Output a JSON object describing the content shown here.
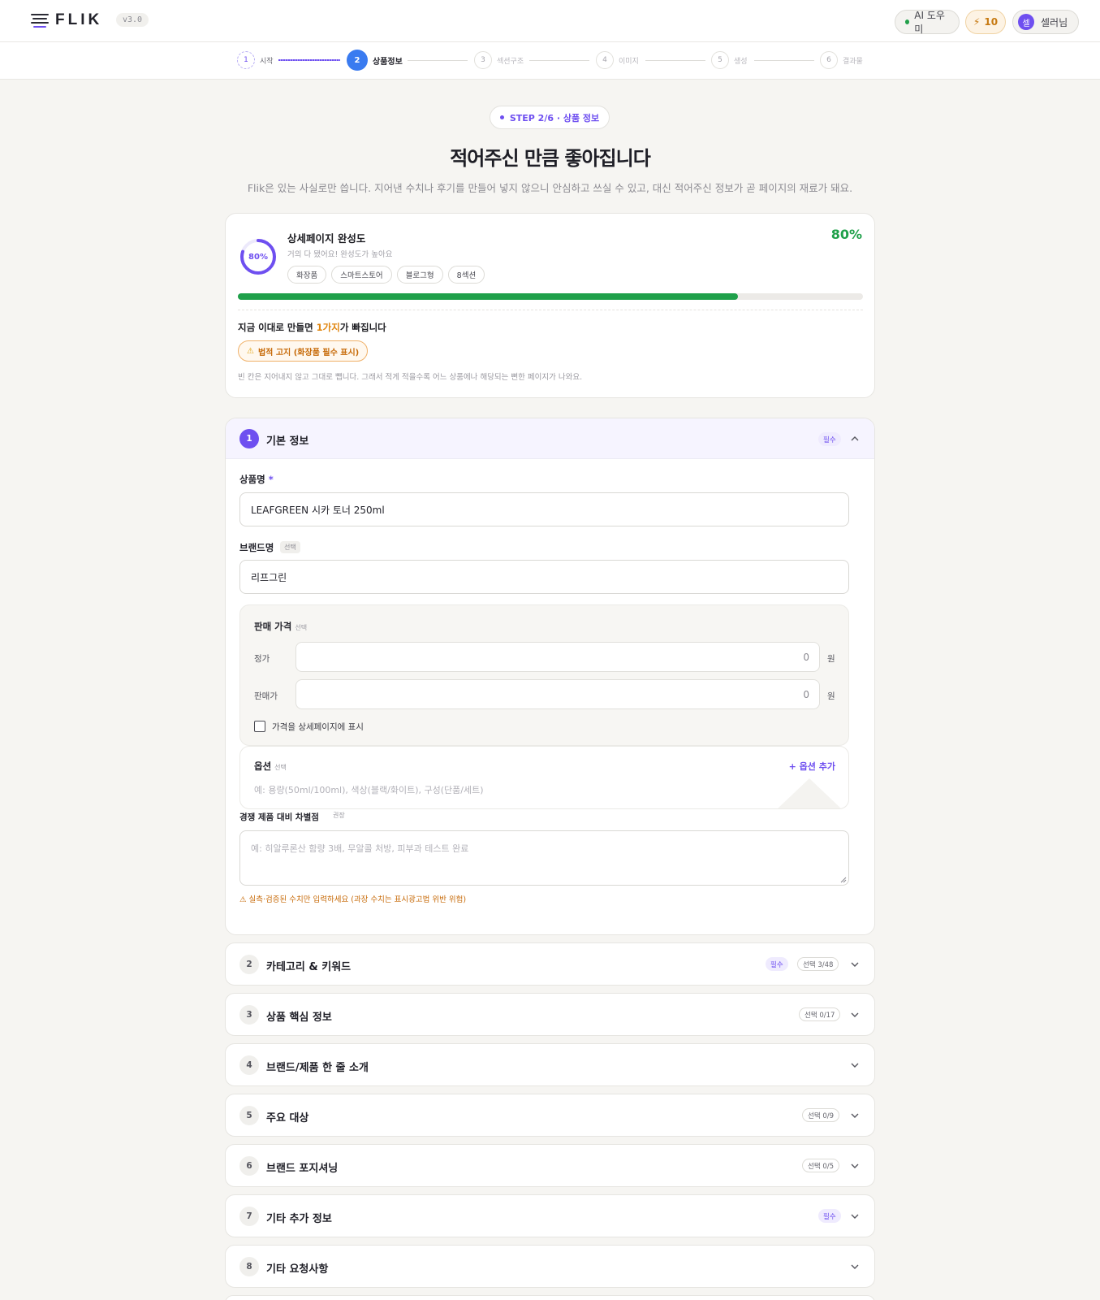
{
  "header": {
    "logo_text": "FLIK",
    "version": "v3.0",
    "ai_button": "AI 도우미",
    "credit_icon": "⚡",
    "credits": "10",
    "user_avatar": "셀",
    "user_name": "셀러님"
  },
  "stepper": {
    "steps": [
      {
        "num": "1",
        "label": "시작",
        "state": "done"
      },
      {
        "num": "2",
        "label": "상품정보",
        "state": "current"
      },
      {
        "num": "3",
        "label": "섹션구조",
        "state": "todo"
      },
      {
        "num": "4",
        "label": "이미지",
        "state": "todo"
      },
      {
        "num": "5",
        "label": "생성",
        "state": "todo"
      },
      {
        "num": "6",
        "label": "결과물",
        "state": "todo"
      }
    ]
  },
  "hero": {
    "badge": "STEP 2/6 · 상품 정보",
    "title": "적어주신 만큼 좋아집니다",
    "subtitle": "Flik은 있는 사실로만 씁니다. 지어낸 수치나 후기를 만들어 넣지 않으니 안심하고 쓰실 수 있고, 대신 적어주신 정보가 곧 페이지의 재료가 돼요."
  },
  "completeness": {
    "ring_label": "80%",
    "title": "상세페이지 완성도",
    "subtitle": "거의 다 됐어요! 완성도가 높아요",
    "percent_label": "80%",
    "progress": 0.8,
    "tags": [
      "화장품",
      "스마트스토어",
      "블로그형",
      "8섹션"
    ],
    "missing_prefix": "지금 이대로 만들면 ",
    "missing_count": "1가지",
    "missing_suffix": "가 빠집니다",
    "missing_item": "법적 고지 (화장품 필수 표시)",
    "note": "빈 칸은 지어내지 않고 그대로 뺍니다. 그래서 적게 적을수록 어느 상품에나 해당되는 뻔한 페이지가 나와요.",
    "accent_color": "#1fa04a"
  },
  "section1": {
    "num": "1",
    "title": "기본 정보",
    "required_badge": "필수",
    "product_name_label": "상품명",
    "product_name_required": "*",
    "product_name_value": "LEAFGREEN 시카 토너 250ml",
    "brand_label": "브랜드명",
    "brand_optional": "선택",
    "brand_value": "리프그린",
    "price": {
      "title": "판매 가격",
      "optional": "선택",
      "list_label": "정가",
      "list_value": "0",
      "sale_label": "판매가",
      "sale_value": "0",
      "unit": "원",
      "show_checkbox_label": "가격을 상세페이지에 표시"
    },
    "options": {
      "title": "옵션",
      "optional": "선택",
      "add_label": "+ 옵션 추가",
      "placeholder": "예: 용량(50ml/100ml), 색상(블랙/화이트), 구성(단품/세트)"
    },
    "differentiator": {
      "label": "경쟁 제품 대비 차별점",
      "recommend": "권장",
      "placeholder": "예: 히알루론산 함량 3배, 무알콜 처방, 피부과 테스트 완료",
      "warning": "⚠ 실측·검증된 수치만 입력하세요 (과장 수치는 표시광고법 위반 위험)"
    }
  },
  "sections": [
    {
      "num": "2",
      "title": "카테고리 & 키워드",
      "required": "필수",
      "count": "선택 3/48"
    },
    {
      "num": "3",
      "title": "상품 핵심 정보",
      "required": "",
      "count": "선택 0/17"
    },
    {
      "num": "4",
      "title": "브랜드/제품 한 줄 소개",
      "required": "",
      "count": ""
    },
    {
      "num": "5",
      "title": "주요 대상",
      "required": "",
      "count": "선택 0/9"
    },
    {
      "num": "6",
      "title": "브랜드 포지셔닝",
      "required": "",
      "count": "선택 0/5"
    },
    {
      "num": "7",
      "title": "기타 추가 정보",
      "required": "필수",
      "count": ""
    },
    {
      "num": "8",
      "title": "기타 요청사항",
      "required": "",
      "count": ""
    }
  ],
  "colors": {
    "brand": "#6e4ff0",
    "current_step": "#3a7bf0",
    "warning": "#c76a08"
  }
}
